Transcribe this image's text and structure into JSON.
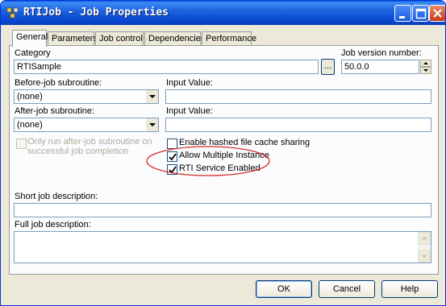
{
  "window": {
    "title": "RTIJob - Job Properties",
    "accent_color": "#0a5fe0"
  },
  "tabs": [
    {
      "label": "General",
      "active": true
    },
    {
      "label": "Parameters",
      "active": false
    },
    {
      "label": "Job control",
      "active": false
    },
    {
      "label": "Dependencies",
      "active": false
    },
    {
      "label": "Performance",
      "active": false
    }
  ],
  "general": {
    "category_label": "Category",
    "category_value": "RTISample",
    "browse_label": "...",
    "job_version_label": "Job version number:",
    "job_version_value": "50.0.0",
    "before_job_label": "Before-job subroutine:",
    "before_job_value": "(none)",
    "before_input_label": "Input Value:",
    "before_input_value": "",
    "after_job_label": "After-job subroutine:",
    "after_job_value": "(none)",
    "after_input_label": "Input Value:",
    "after_input_value": "",
    "only_run_label_line1": "Only run after-job subroutine on",
    "only_run_label_line2": "successful job completion",
    "only_run_checked": false,
    "hashed_cache_label": "Enable hashed file cache sharing",
    "hashed_cache_checked": false,
    "allow_multiple_label": "Allow Multiple Instance",
    "allow_multiple_checked": true,
    "rti_service_label": "RTI Service Enabled",
    "rti_service_checked": true,
    "highlight_color": "#d0302a",
    "short_desc_label": "Short job description:",
    "short_desc_value": "",
    "full_desc_label": "Full job description:",
    "full_desc_value": ""
  },
  "footer": {
    "ok_label": "OK",
    "cancel_label": "Cancel",
    "help_label": "Help"
  }
}
